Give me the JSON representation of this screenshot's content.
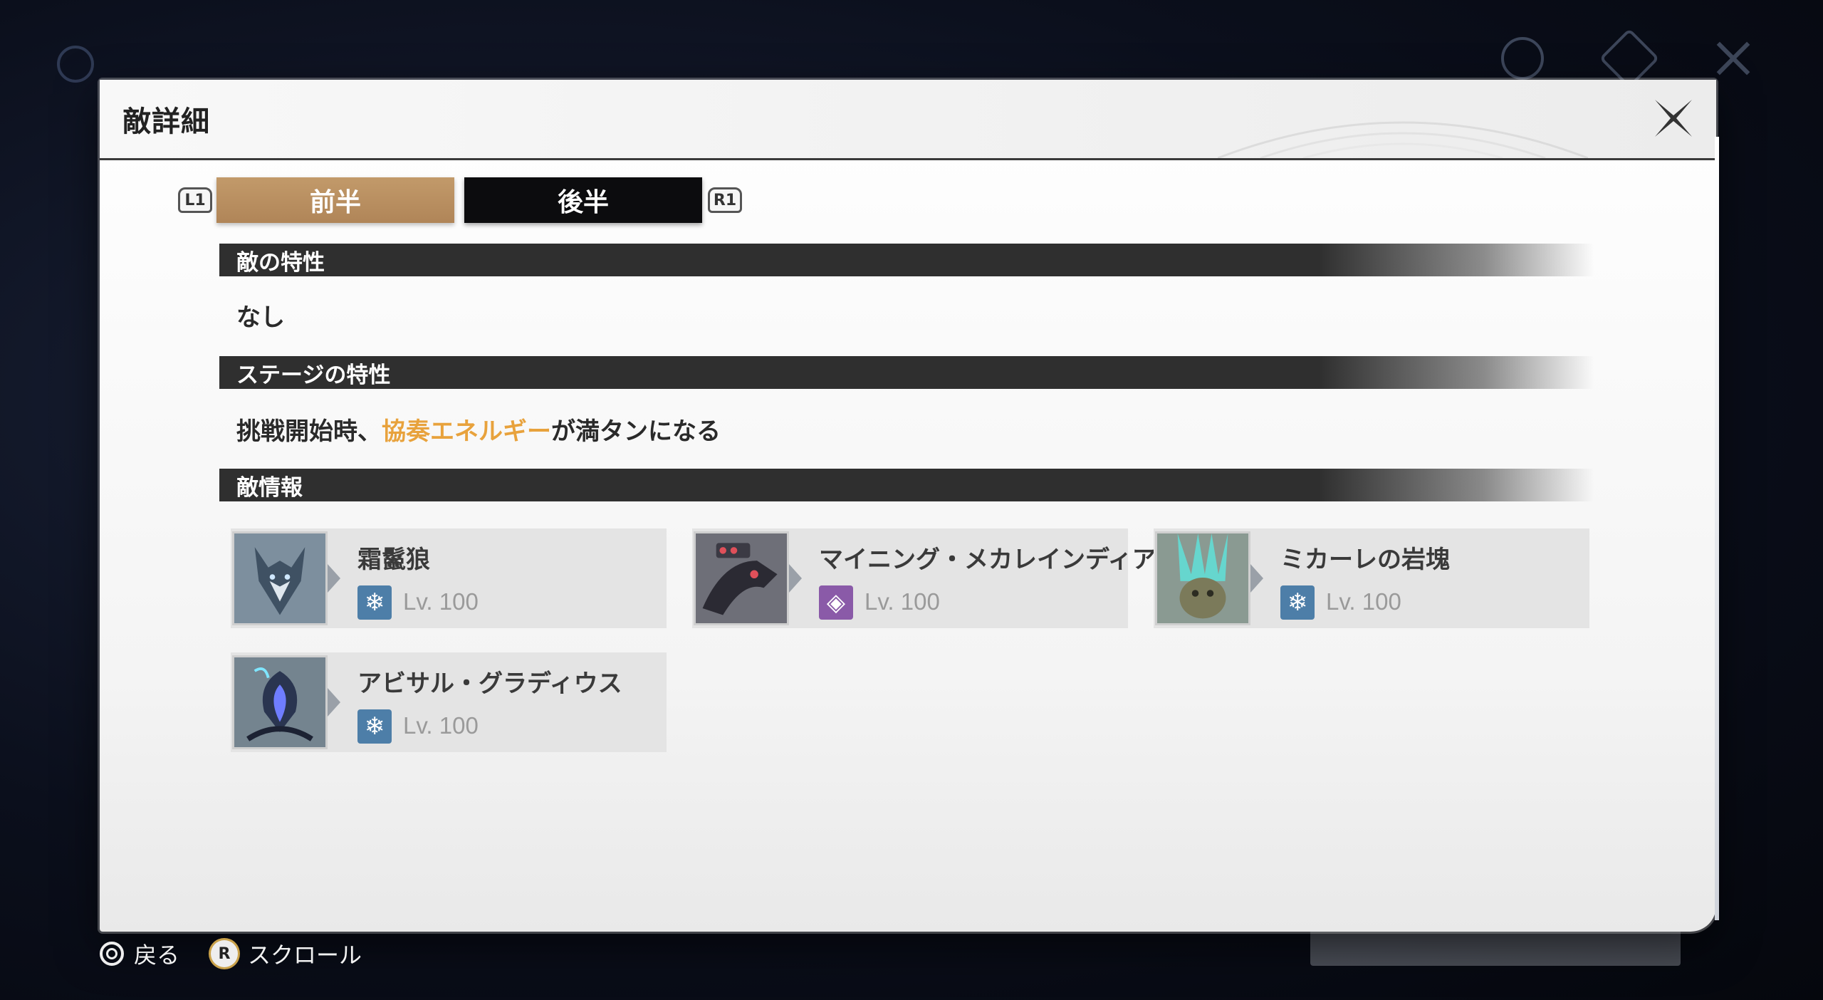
{
  "modal": {
    "title": "敵詳細"
  },
  "tabs": {
    "left_shoulder": "L1",
    "right_shoulder": "R1",
    "items": [
      {
        "label": "前半",
        "active": true
      },
      {
        "label": "後半",
        "active": false
      }
    ]
  },
  "sections": {
    "enemy_traits": {
      "heading": "敵の特性",
      "text": "なし"
    },
    "stage_traits": {
      "heading": "ステージの特性",
      "text_before": "挑戦開始時、",
      "text_highlight": "協奏エネルギー",
      "text_after": "が満タンになる",
      "highlight_color": "#e8a23c"
    },
    "enemy_info": {
      "heading": "敵情報"
    }
  },
  "enemies": [
    {
      "name": "霜鬣狼",
      "level": "Lv. 100",
      "element_icon": "glacio-snowflake-icon",
      "element_glyph": "❄"
    },
    {
      "name": "マイニング・メカレインディア",
      "level": "Lv. 100",
      "element_icon": "havoc-icon",
      "element_glyph": "◈"
    },
    {
      "name": "ミカーレの岩塊",
      "level": "Lv. 100",
      "element_icon": "glacio-snowflake-icon",
      "element_glyph": "❄"
    },
    {
      "name": "アビサル・グラディウス",
      "level": "Lv. 100",
      "element_icon": "glacio-snowflake-icon",
      "element_glyph": "❄"
    }
  ],
  "footer": {
    "back_label": "戻る",
    "scroll_label": "スクロール",
    "stick_glyph": "R"
  },
  "colors": {
    "tab_active": "#b08558",
    "tab_inactive": "#0c0c0e",
    "section_bar": "#2f2f2f",
    "glacio": "#4d7ea8",
    "havoc": "#8a5aa8"
  }
}
